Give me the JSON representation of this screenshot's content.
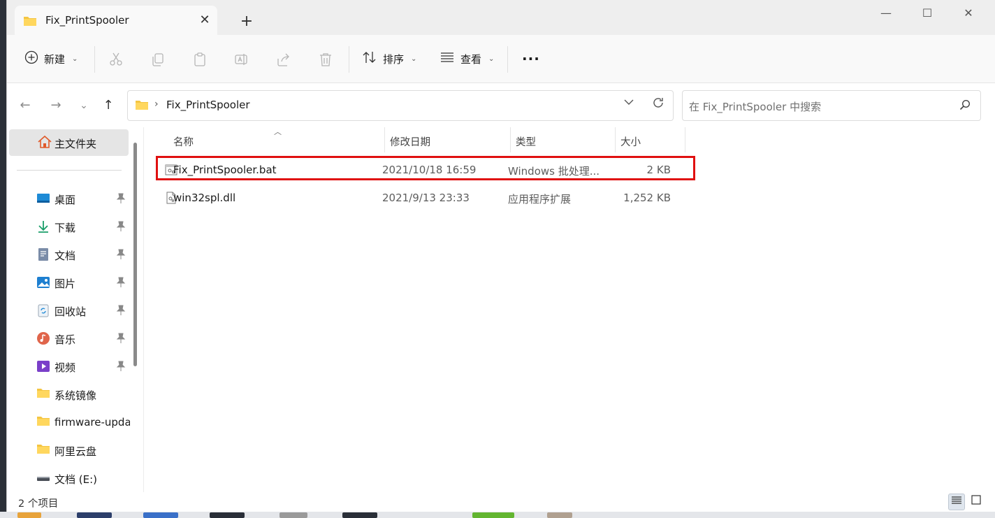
{
  "tab": {
    "title": "Fix_PrintSpooler",
    "close": "✕",
    "new_tab": "+"
  },
  "window_controls": {
    "minimize": "—",
    "maximize": "☐",
    "close": "✕"
  },
  "toolbar": {
    "new_label": "新建",
    "sort_label": "排序",
    "view_label": "查看",
    "more_label": "···"
  },
  "address": {
    "separator": "›",
    "path": "Fix_PrintSpooler"
  },
  "search": {
    "placeholder": "在 Fix_PrintSpooler 中搜索"
  },
  "sidebar": {
    "home": "主文件夹",
    "items": [
      {
        "label": "桌面",
        "icon": "desktop-icon",
        "pinned": true
      },
      {
        "label": "下载",
        "icon": "download-icon",
        "pinned": true
      },
      {
        "label": "文档",
        "icon": "document-icon",
        "pinned": true
      },
      {
        "label": "图片",
        "icon": "picture-icon",
        "pinned": true
      },
      {
        "label": "回收站",
        "icon": "recycle-bin-icon",
        "pinned": true
      },
      {
        "label": "音乐",
        "icon": "music-icon",
        "pinned": true
      },
      {
        "label": "视频",
        "icon": "video-icon",
        "pinned": true
      },
      {
        "label": "系统镜像",
        "icon": "folder-icon",
        "pinned": false
      },
      {
        "label": "firmware-upda",
        "icon": "folder-icon",
        "pinned": false
      },
      {
        "label": "阿里云盘",
        "icon": "folder-icon",
        "pinned": false
      },
      {
        "label": "文档 (E:)",
        "icon": "drive-icon",
        "pinned": false
      }
    ]
  },
  "columns": {
    "name": "名称",
    "date": "修改日期",
    "type": "类型",
    "size": "大小"
  },
  "files": [
    {
      "name": "Fix_PrintSpooler.bat",
      "date": "2021/10/18 16:59",
      "type": "Windows 批处理...",
      "size": "2 KB",
      "icon": "batch-file-icon"
    },
    {
      "name": "win32spl.dll",
      "date": "2021/9/13 23:33",
      "type": "应用程序扩展",
      "size": "1,252 KB",
      "icon": "dll-file-icon"
    }
  ],
  "status": {
    "item_count": "2 个项目"
  },
  "colors": {
    "highlight": "#e01010",
    "folder": "#f4c542",
    "accent": "#0067c0"
  }
}
